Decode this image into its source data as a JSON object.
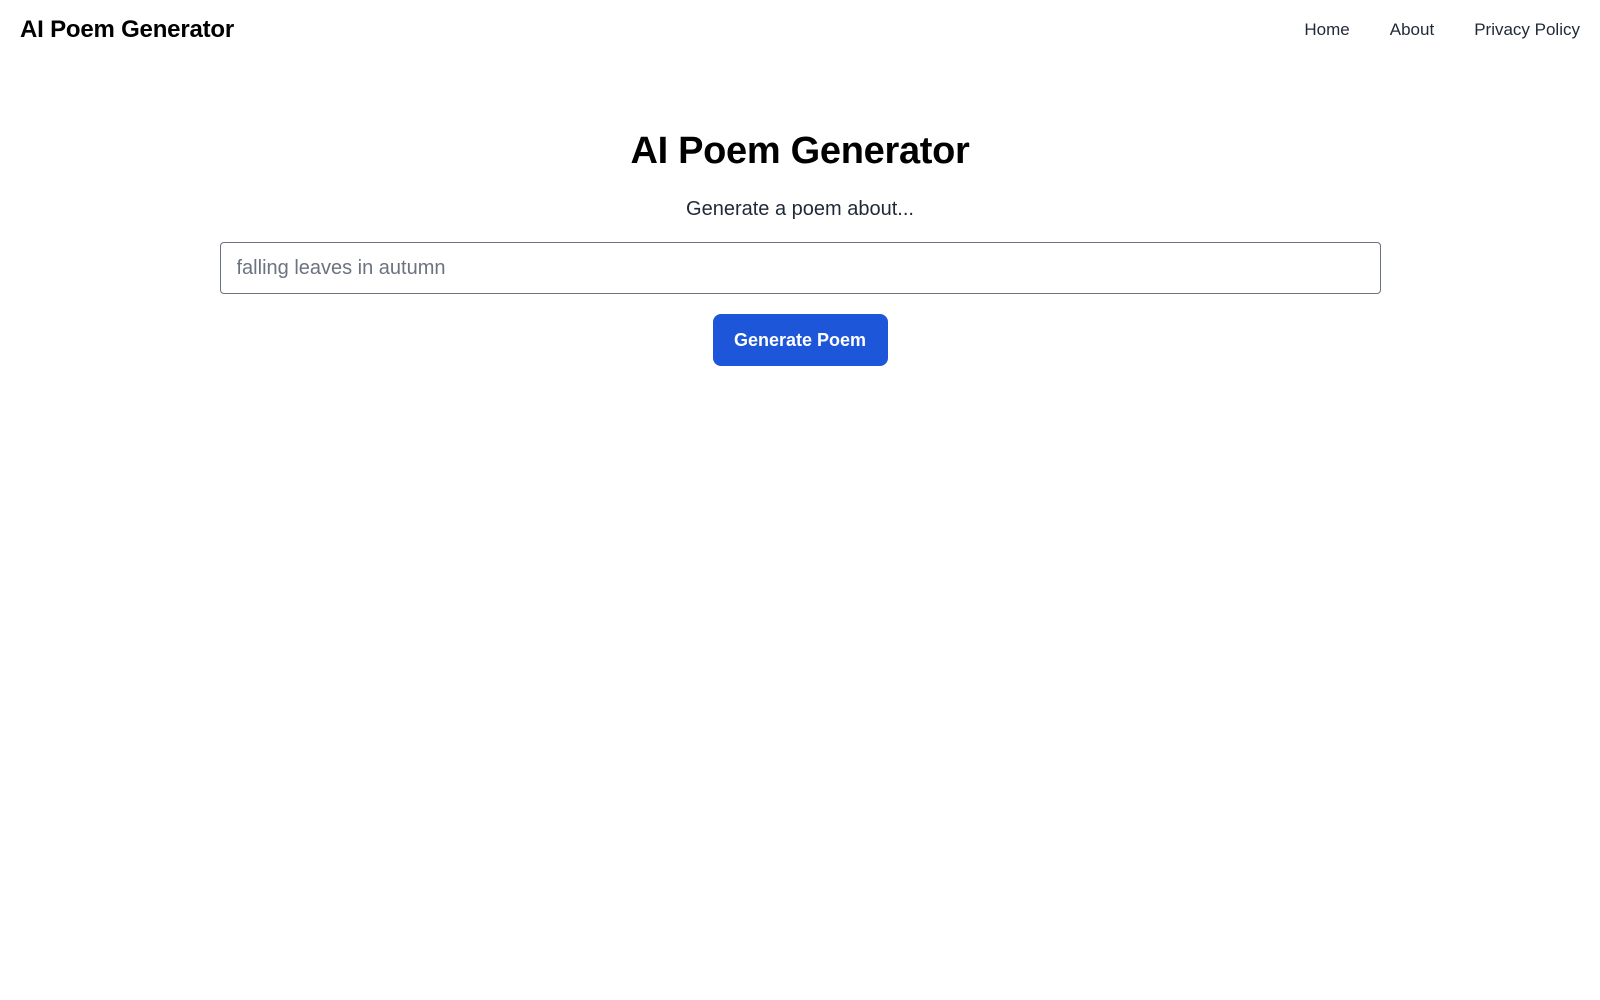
{
  "header": {
    "brand": "AI Poem Generator",
    "nav": [
      {
        "label": "Home"
      },
      {
        "label": "About"
      },
      {
        "label": "Privacy Policy"
      }
    ]
  },
  "main": {
    "title": "AI Poem Generator",
    "subtitle": "Generate a poem about...",
    "input": {
      "value": "",
      "placeholder": "falling leaves in autumn"
    },
    "button_label": "Generate Poem"
  },
  "colors": {
    "accent": "#1d56d8",
    "text": "#111827",
    "background": "#ffffff"
  }
}
